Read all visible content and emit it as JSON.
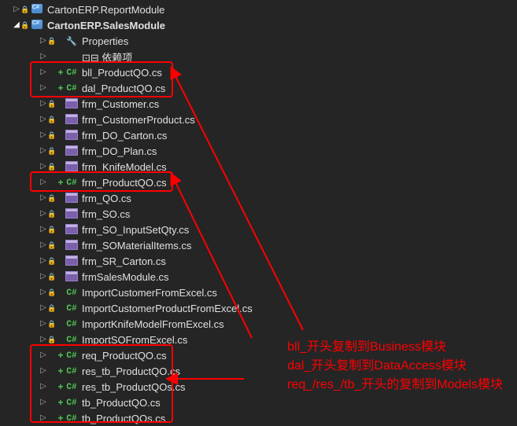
{
  "parent_truncated": "CartonERP.ReportModule",
  "project": "CartonERP.SalesModule",
  "children": [
    {
      "expander": "▷",
      "lock": "🔒",
      "plus": "",
      "icon": "wrench",
      "label": "Properties",
      "indent": 50
    },
    {
      "expander": "▷",
      "lock": "",
      "plus": "",
      "icon": "ref",
      "label": "⊡⊟ 依赖项",
      "indent": 50
    },
    {
      "expander": "▷",
      "lock": "",
      "plus": "+",
      "icon": "cs",
      "label": "bll_ProductQO.cs",
      "indent": 50
    },
    {
      "expander": "▷",
      "lock": "",
      "plus": "+",
      "icon": "cs",
      "label": "dal_ProductQO.cs",
      "indent": 50
    },
    {
      "expander": "▷",
      "lock": "🔒",
      "plus": "",
      "icon": "frm",
      "label": "frm_Customer.cs",
      "indent": 50
    },
    {
      "expander": "▷",
      "lock": "🔒",
      "plus": "",
      "icon": "frm",
      "label": "frm_CustomerProduct.cs",
      "indent": 50
    },
    {
      "expander": "▷",
      "lock": "🔒",
      "plus": "",
      "icon": "frm",
      "label": "frm_DO_Carton.cs",
      "indent": 50
    },
    {
      "expander": "▷",
      "lock": "🔒",
      "plus": "",
      "icon": "frm",
      "label": "frm_DO_Plan.cs",
      "indent": 50
    },
    {
      "expander": "▷",
      "lock": "🔒",
      "plus": "",
      "icon": "frm",
      "label": "frm_KnifeModel.cs",
      "indent": 50
    },
    {
      "expander": "▷",
      "lock": "",
      "plus": "+",
      "icon": "cs",
      "label": "frm_ProductQO.cs",
      "indent": 50
    },
    {
      "expander": "▷",
      "lock": "🔒",
      "plus": "",
      "icon": "frm",
      "label": "frm_QO.cs",
      "indent": 50
    },
    {
      "expander": "▷",
      "lock": "🔒",
      "plus": "",
      "icon": "frm",
      "label": "frm_SO.cs",
      "indent": 50
    },
    {
      "expander": "▷",
      "lock": "🔒",
      "plus": "",
      "icon": "frm",
      "label": "frm_SO_InputSetQty.cs",
      "indent": 50
    },
    {
      "expander": "▷",
      "lock": "🔒",
      "plus": "",
      "icon": "frm",
      "label": "frm_SOMaterialItems.cs",
      "indent": 50
    },
    {
      "expander": "▷",
      "lock": "🔒",
      "plus": "",
      "icon": "frm",
      "label": "frm_SR_Carton.cs",
      "indent": 50
    },
    {
      "expander": "▷",
      "lock": "🔒",
      "plus": "",
      "icon": "frm",
      "label": "frmSalesModule.cs",
      "indent": 50
    },
    {
      "expander": "▷",
      "lock": "🔒",
      "plus": "",
      "icon": "cs",
      "label": "ImportCustomerFromExcel.cs",
      "indent": 50
    },
    {
      "expander": "▷",
      "lock": "🔒",
      "plus": "",
      "icon": "cs",
      "label": "ImportCustomerProductFromExcel.cs",
      "indent": 50
    },
    {
      "expander": "▷",
      "lock": "🔒",
      "plus": "",
      "icon": "cs",
      "label": "ImportKnifeModelFromExcel.cs",
      "indent": 50
    },
    {
      "expander": "▷",
      "lock": "🔒",
      "plus": "",
      "icon": "cs",
      "label": "ImportSOFromExcel.cs",
      "indent": 50
    },
    {
      "expander": "▷",
      "lock": "",
      "plus": "+",
      "icon": "cs",
      "label": "req_ProductQO.cs",
      "indent": 50
    },
    {
      "expander": "▷",
      "lock": "",
      "plus": "+",
      "icon": "cs",
      "label": "res_tb_ProductQO.cs",
      "indent": 50
    },
    {
      "expander": "▷",
      "lock": "",
      "plus": "+",
      "icon": "cs",
      "label": "res_tb_ProductQOs.cs",
      "indent": 50
    },
    {
      "expander": "▷",
      "lock": "",
      "plus": "+",
      "icon": "cs",
      "label": "tb_ProductQO.cs",
      "indent": 50
    },
    {
      "expander": "▷",
      "lock": "",
      "plus": "+",
      "icon": "cs",
      "label": "tb_ProductQOs.cs",
      "indent": 50
    }
  ],
  "annotations": [
    "bll_开头复制到Business模块",
    "dal_开头复制到DataAccess模块",
    "req_/res_/tb_开头的复制到Models模块"
  ]
}
